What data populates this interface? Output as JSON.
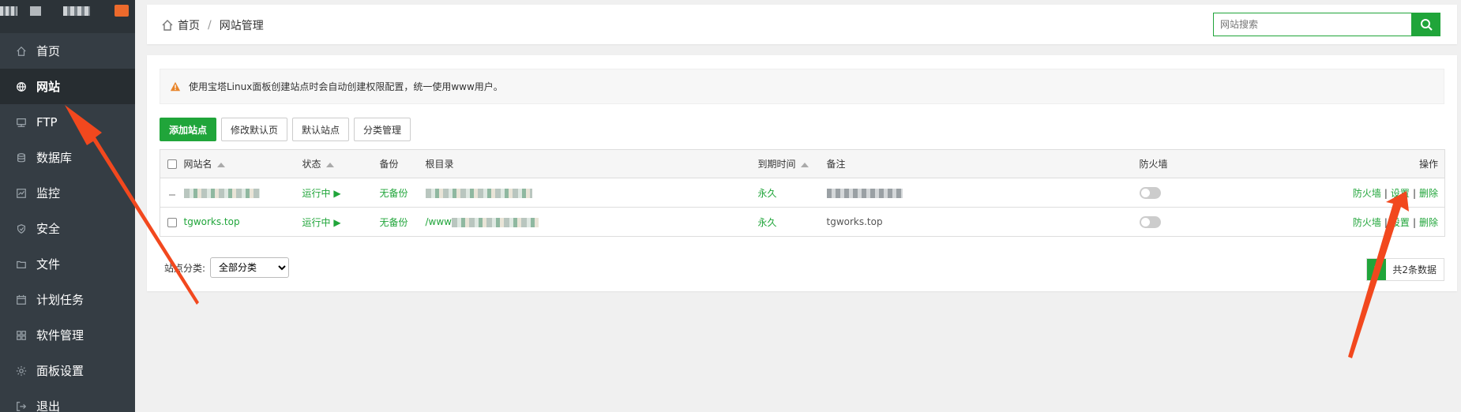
{
  "sidebar": {
    "items": [
      {
        "label": "首页",
        "icon": "home-icon"
      },
      {
        "label": "网站",
        "icon": "globe-icon",
        "active": true
      },
      {
        "label": "FTP",
        "icon": "ftp-icon"
      },
      {
        "label": "数据库",
        "icon": "database-icon"
      },
      {
        "label": "监控",
        "icon": "monitor-icon"
      },
      {
        "label": "安全",
        "icon": "shield-icon"
      },
      {
        "label": "文件",
        "icon": "folder-icon"
      },
      {
        "label": "计划任务",
        "icon": "calendar-icon"
      },
      {
        "label": "软件管理",
        "icon": "apps-icon"
      },
      {
        "label": "面板设置",
        "icon": "gear-icon"
      },
      {
        "label": "退出",
        "icon": "logout-icon"
      }
    ]
  },
  "header": {
    "breadcrumb_home": "首页",
    "breadcrumb_sep": "/",
    "breadcrumb_current": "网站管理",
    "search_placeholder": "网站搜索"
  },
  "notice": "使用宝塔Linux面板创建站点时会自动创建权限配置，统一使用www用户。",
  "toolbar": {
    "add_site": "添加站点",
    "edit_default_page": "修改默认页",
    "default_site": "默认站点",
    "category_manage": "分类管理"
  },
  "table": {
    "headers": {
      "name": "网站名",
      "status": "状态",
      "backup": "备份",
      "root": "根目录",
      "expire": "到期时间",
      "remark": "备注",
      "firewall": "防火墙",
      "ops": "操作"
    },
    "rows": [
      {
        "name": "",
        "status": "运行中 ▶",
        "backup": "无备份",
        "root": "",
        "expire": "永久",
        "remark": "",
        "ops": [
          "防火墙",
          "设置",
          "删除"
        ]
      },
      {
        "name": "tgworks.top",
        "status": "运行中 ▶",
        "backup": "无备份",
        "root": "/www",
        "expire": "永久",
        "remark": "tgworks.top",
        "ops": [
          "防火墙",
          "设置",
          "删除"
        ]
      }
    ]
  },
  "footer": {
    "category_label": "站点分类:",
    "category_value": "全部分类",
    "page": "1",
    "total": "共2条数据"
  },
  "colors": {
    "accent": "#20a53a",
    "sidebar": "#353d44",
    "arrow": "#f2481e"
  }
}
